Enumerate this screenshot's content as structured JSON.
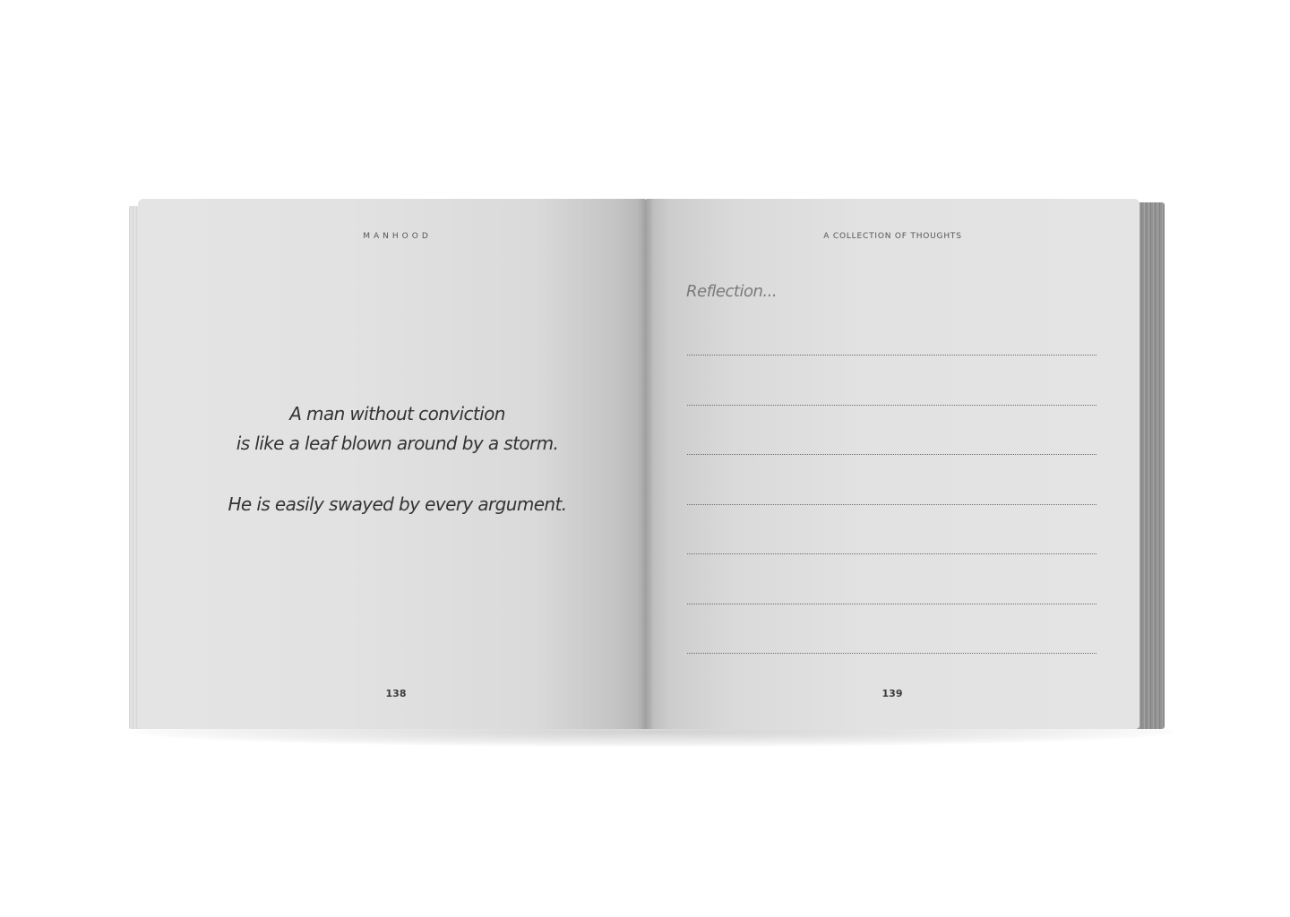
{
  "left_page": {
    "running_head": "MANHOOD",
    "quote": {
      "line1": "A man without conviction",
      "line2": "is like a leaf blown around by a storm.",
      "line3": "He is easily swayed by every argument."
    },
    "page_number": "138"
  },
  "right_page": {
    "running_head": "A COLLECTION OF THOUGHTS",
    "heading": "Reflection...",
    "blank_line_count": 7,
    "page_number": "139"
  },
  "colors": {
    "background": "#ffffff",
    "page": "#e2e2e2",
    "text": "#333333"
  }
}
